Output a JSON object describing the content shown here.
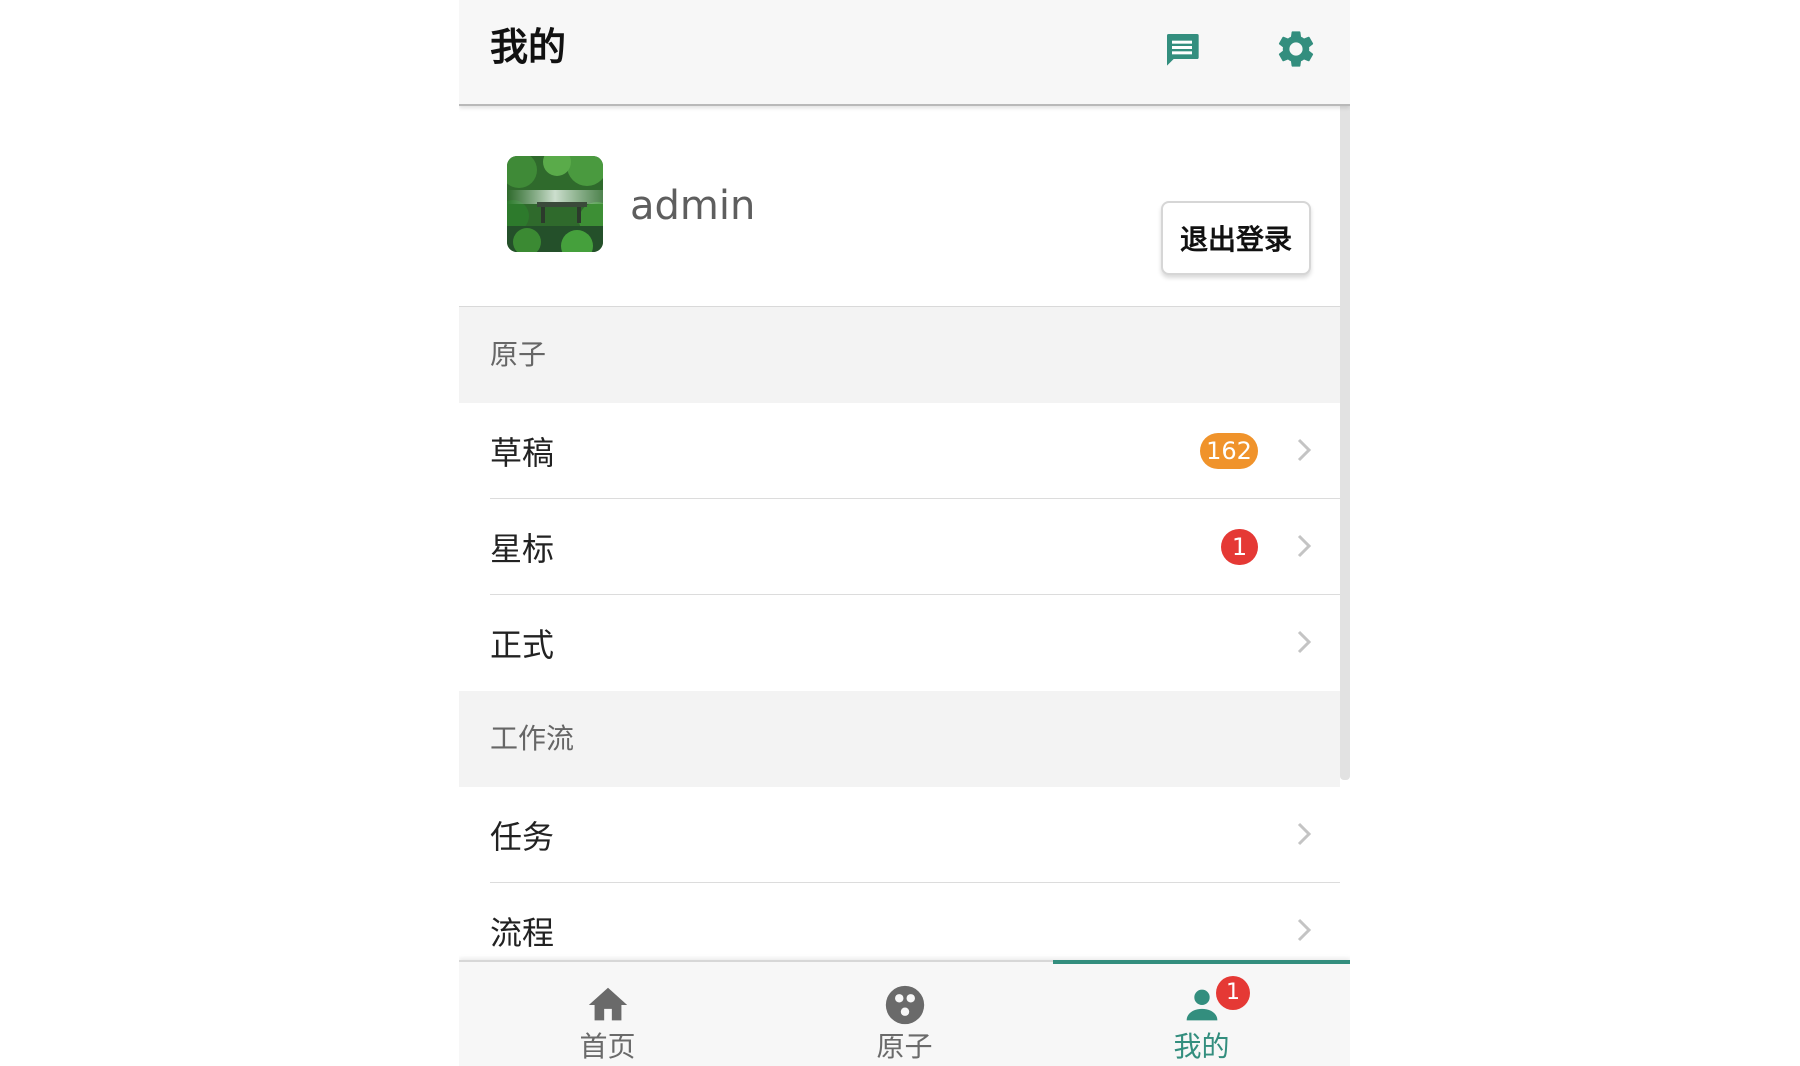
{
  "header": {
    "title": "我的",
    "icons": [
      "message-icon",
      "gear-icon"
    ]
  },
  "profile": {
    "username": "admin",
    "logout_label": "退出登录"
  },
  "groups": [
    {
      "title": "原子",
      "items": [
        {
          "label": "草稿",
          "badge": "162",
          "badge_color": "#f0932b"
        },
        {
          "label": "星标",
          "badge": "1",
          "badge_color": "#e53935"
        },
        {
          "label": "正式"
        }
      ]
    },
    {
      "title": "工作流",
      "items": [
        {
          "label": "任务"
        },
        {
          "label": "流程"
        }
      ]
    }
  ],
  "tabbar": {
    "tabs": [
      {
        "label": "首页",
        "icon": "home-icon"
      },
      {
        "label": "原子",
        "icon": "atom-icon"
      },
      {
        "label": "我的",
        "icon": "person-icon",
        "badge": "1",
        "active": true
      }
    ]
  },
  "colors": {
    "accent": "#338e7e",
    "badge_red": "#e53935",
    "badge_orange": "#f0932b"
  }
}
